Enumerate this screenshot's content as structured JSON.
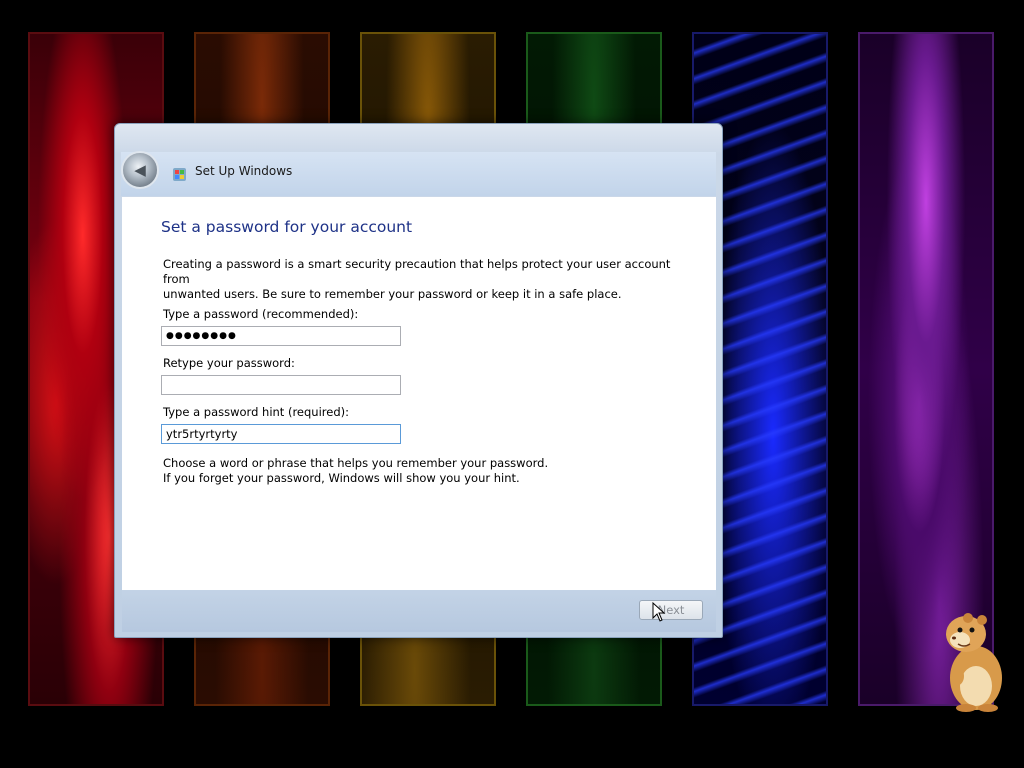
{
  "window": {
    "title": "Set Up Windows",
    "icon": "windows-setup-icon"
  },
  "page": {
    "heading": "Set a password for your account",
    "description_line1": "Creating a password is a smart security precaution that helps protect your user account from",
    "description_line2": "unwanted users. Be sure to remember your password or keep it in a safe place."
  },
  "form": {
    "password_label": "Type a password (recommended):",
    "password_value": "●●●●●●●●",
    "retype_label": "Retype your password:",
    "retype_value": "",
    "hint_label": "Type a password hint (required):",
    "hint_value": "ytr5rtyrtyrty"
  },
  "help": {
    "line1": "Choose a word or phrase that helps you remember your password.",
    "line2": "If you forget your password, Windows will show you your hint."
  },
  "footer": {
    "next_label": "Next"
  },
  "colors": {
    "heading": "#1e3287",
    "footer_band": "#bfd0e4",
    "desktop": "#000000"
  }
}
